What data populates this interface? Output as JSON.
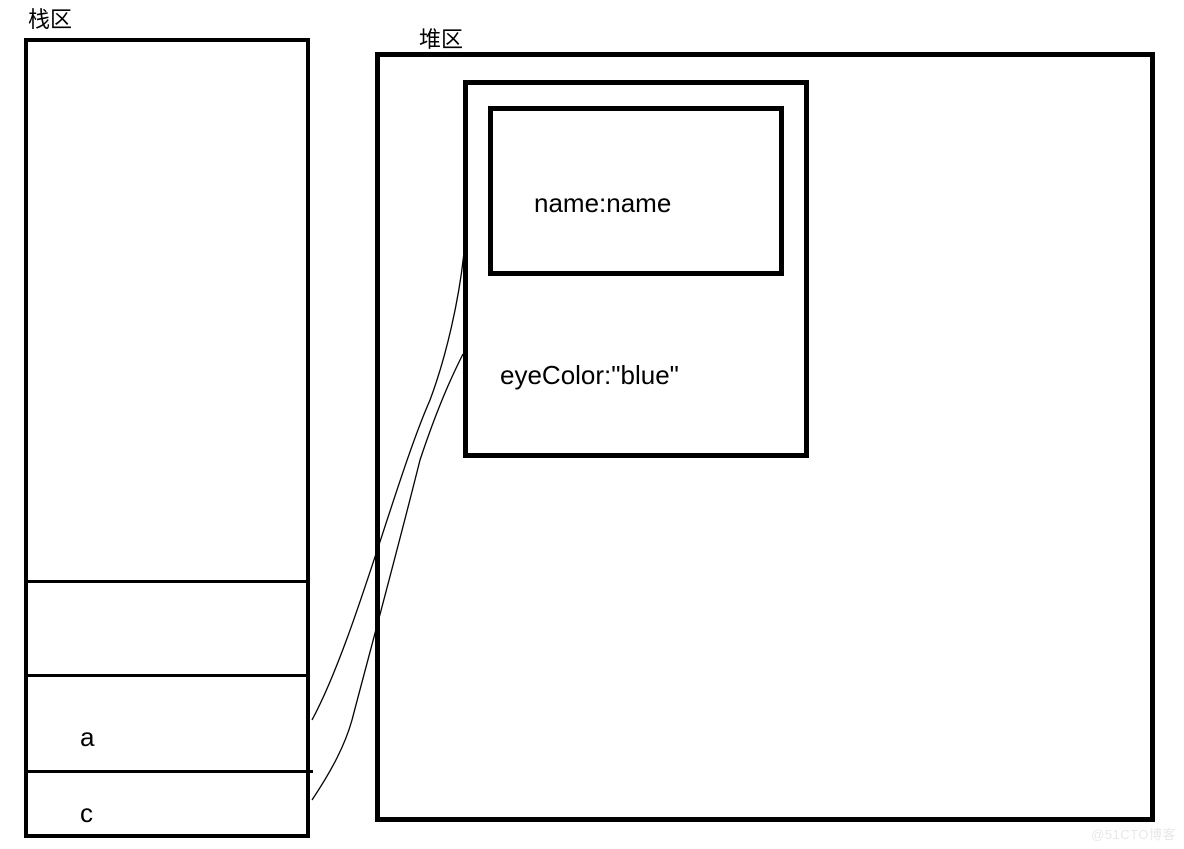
{
  "diagram": {
    "stack": {
      "label": "栈区",
      "slots": {
        "a": "a",
        "c": "c"
      }
    },
    "heap": {
      "label": "堆区",
      "object": {
        "nameField": "name:name",
        "eyeColorField": "eyeColor:\"blue\""
      }
    },
    "watermark": "@51CTO博客"
  }
}
